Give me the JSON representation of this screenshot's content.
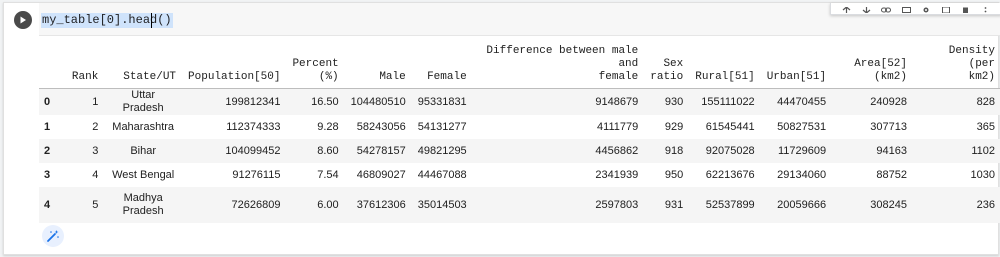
{
  "cell": {
    "code": "my_table[0].head()"
  },
  "toolbar": {
    "icons": [
      "arrow-up-icon",
      "arrow-down-icon",
      "link-icon",
      "comment-icon",
      "settings-icon",
      "mirror-icon",
      "delete-icon",
      "more-icon"
    ]
  },
  "table": {
    "columns": [
      "",
      "Rank",
      "State/UT",
      "Population[50]",
      "Percent\n(%)",
      "Male",
      "Female",
      "Difference between male and\nfemale",
      "Sex\nratio",
      "Rural[51]",
      "Urban[51]",
      "Area[52]\n(km2)",
      "Density (per\nkm2)"
    ],
    "rows": [
      [
        "0",
        "1",
        "Uttar Pradesh",
        "199812341",
        "16.50",
        "104480510",
        "95331831",
        "9148679",
        "930",
        "155111022",
        "44470455",
        "240928",
        "828"
      ],
      [
        "1",
        "2",
        "Maharashtra",
        "112374333",
        "9.28",
        "58243056",
        "54131277",
        "4111779",
        "929",
        "61545441",
        "50827531",
        "307713",
        "365"
      ],
      [
        "2",
        "3",
        "Bihar",
        "104099452",
        "8.60",
        "54278157",
        "49821295",
        "4456862",
        "918",
        "92075028",
        "11729609",
        "94163",
        "1102"
      ],
      [
        "3",
        "4",
        "West Bengal",
        "91276115",
        "7.54",
        "46809027",
        "44467088",
        "2341939",
        "950",
        "62213676",
        "29134060",
        "88752",
        "1030"
      ],
      [
        "4",
        "5",
        "Madhya\nPradesh",
        "72626809",
        "6.00",
        "37612306",
        "35014503",
        "2597803",
        "931",
        "52537899",
        "20059666",
        "308245",
        "236"
      ]
    ]
  },
  "colors": {
    "selection": "#cfe3fb",
    "row_stripe": "#f5f5f5",
    "magic_accent": "#1a73e8"
  },
  "icons": {
    "run": "play-icon",
    "magic": "magic-wand-icon"
  }
}
